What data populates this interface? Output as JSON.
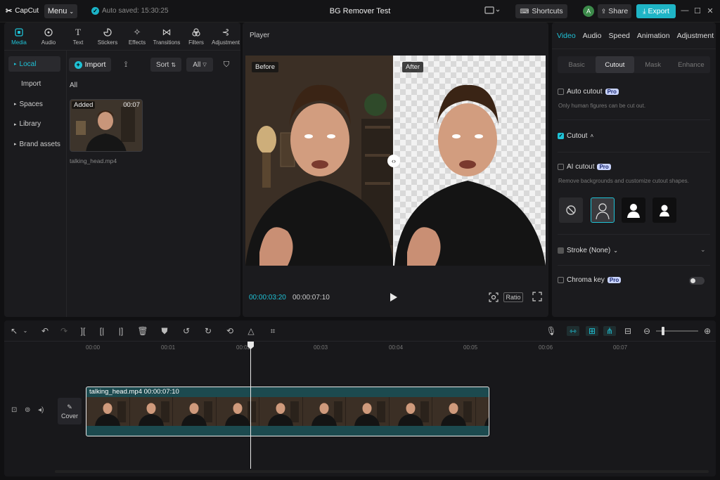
{
  "titlebar": {
    "app_name": "CapCut",
    "menu_label": "Menu",
    "autosave": "Auto saved: 15:30:25",
    "project_title": "BG Remover Test",
    "shortcuts_label": "Shortcuts",
    "avatar_letter": "A",
    "share_label": "Share",
    "export_label": "Export"
  },
  "left_tabs": [
    {
      "label": "Media",
      "icon": "media-icon"
    },
    {
      "label": "Audio",
      "icon": "audio-icon"
    },
    {
      "label": "Text",
      "icon": "text-icon"
    },
    {
      "label": "Stickers",
      "icon": "sticker-icon"
    },
    {
      "label": "Effects",
      "icon": "effects-icon"
    },
    {
      "label": "Transitions",
      "icon": "transitions-icon"
    },
    {
      "label": "Filters",
      "icon": "filters-icon"
    },
    {
      "label": "Adjustment",
      "icon": "adjustment-icon"
    }
  ],
  "sidenav": {
    "local": "Local",
    "import": "Import",
    "spaces": "Spaces",
    "library": "Library",
    "brand_assets": "Brand assets"
  },
  "media": {
    "import_label": "Import",
    "sort_label": "Sort",
    "filter_all": "All",
    "section_all": "All",
    "card_tag": "Added",
    "card_duration": "00:07",
    "card_name": "talking_head.mp4"
  },
  "player": {
    "label": "Player",
    "before_label": "Before",
    "after_label": "After",
    "current_time": "00:00:03:20",
    "total_time": "00:00:07:10",
    "ratio_label": "Ratio"
  },
  "right_tabs": [
    "Video",
    "Audio",
    "Speed",
    "Animation",
    "Adjustment"
  ],
  "sub_tabs": [
    "Basic",
    "Cutout",
    "Mask",
    "Enhance"
  ],
  "cutout": {
    "auto_cutout": "Auto cutout",
    "pro": "Pro",
    "auto_hint": "Only human figures can be cut out.",
    "cutout_label": "Cutout",
    "ai_cutout": "AI cutout",
    "ai_hint": "Remove backgrounds and customize cutout shapes.",
    "stroke_label": "Stroke (None)",
    "chroma_label": "Chroma key"
  },
  "timeline": {
    "ticks": [
      "00:00",
      "00:01",
      "00:02",
      "00:03",
      "00:04",
      "00:05",
      "00:06",
      "00:07"
    ],
    "cover_label": "Cover",
    "clip_title": "talking_head.mp4   00:00:07:10"
  },
  "colors": {
    "accent": "#1fc2d6",
    "export": "#1fb5c6",
    "clip": "#1c4a4f"
  }
}
